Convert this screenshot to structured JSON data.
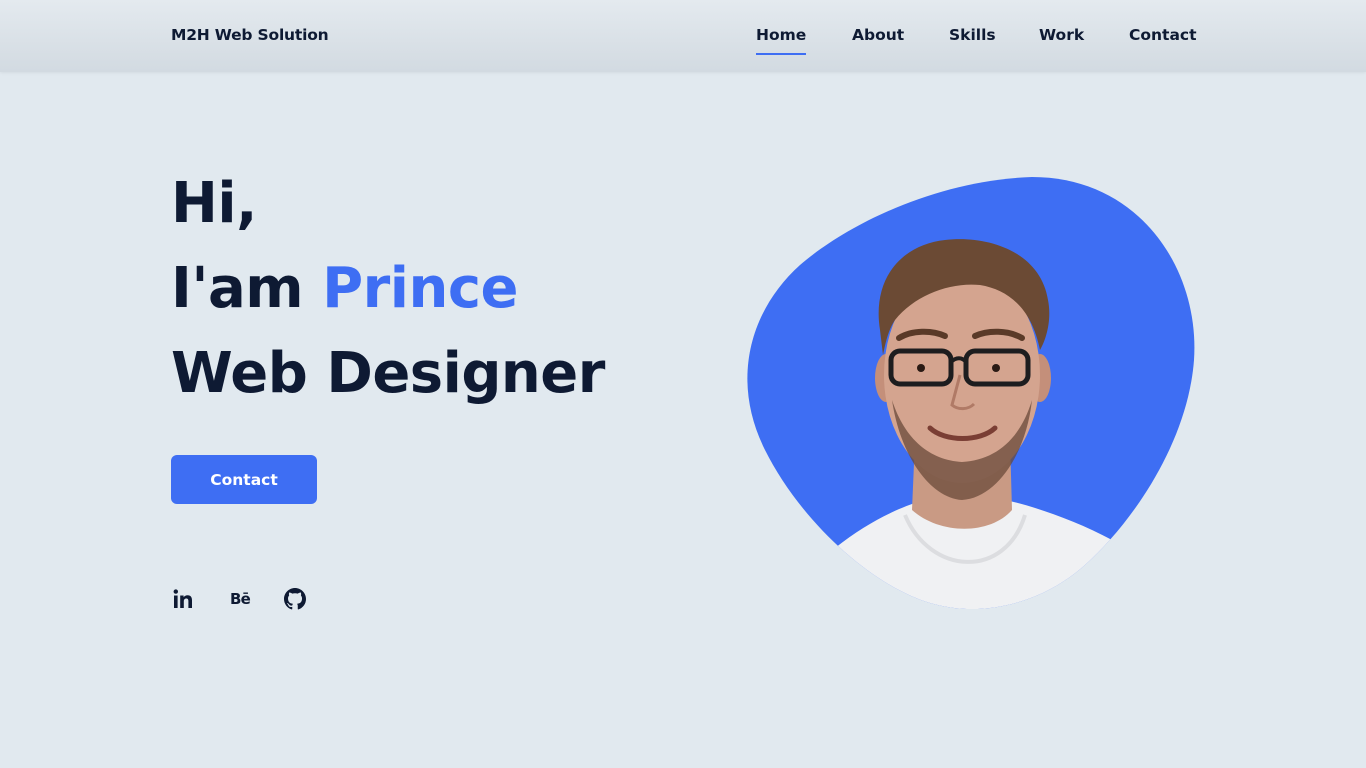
{
  "header": {
    "brand": "M2H Web Solution",
    "nav": [
      {
        "label": "Home",
        "active": true
      },
      {
        "label": "About",
        "active": false
      },
      {
        "label": "Skills",
        "active": false
      },
      {
        "label": "Work",
        "active": false
      },
      {
        "label": "Contact",
        "active": false
      }
    ]
  },
  "hero": {
    "greeting": "Hi,",
    "intro_prefix": "I'am",
    "name": "Prince",
    "role": "Web Designer",
    "cta_label": "Contact"
  },
  "social": {
    "behance_text": "Bē",
    "icons": [
      "linkedin-icon",
      "behance-icon",
      "github-icon"
    ]
  },
  "colors": {
    "accent": "#3e6ef3",
    "text": "#0e1a33",
    "background": "#e1e9ef"
  }
}
